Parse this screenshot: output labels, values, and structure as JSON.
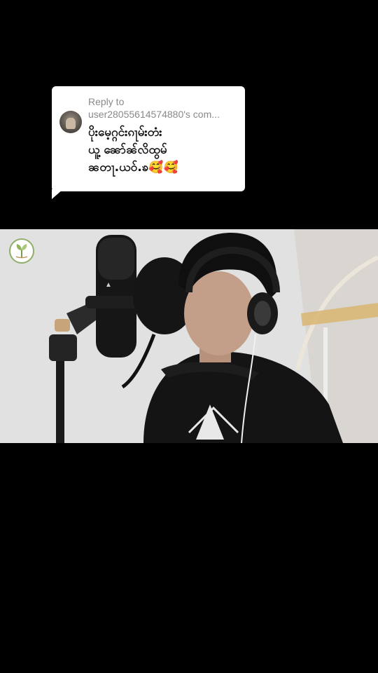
{
  "reply": {
    "label": "Reply to",
    "username": "user28055614574880's com...",
    "comment_lines": [
      "ပိုးမေ့ဂ္ဂင်းၵႃမ်းတံး",
      "ယူ့ ၼော်ၼ်လိထွမ်",
      "ၼတႃ.ယဝ်.ၶ🥰🥰"
    ]
  },
  "video": {
    "watermark_icon": "leaf-logo-icon"
  },
  "colors": {
    "background": "#000000",
    "card": "#ffffff",
    "secondary_text": "#8a8a8a"
  }
}
